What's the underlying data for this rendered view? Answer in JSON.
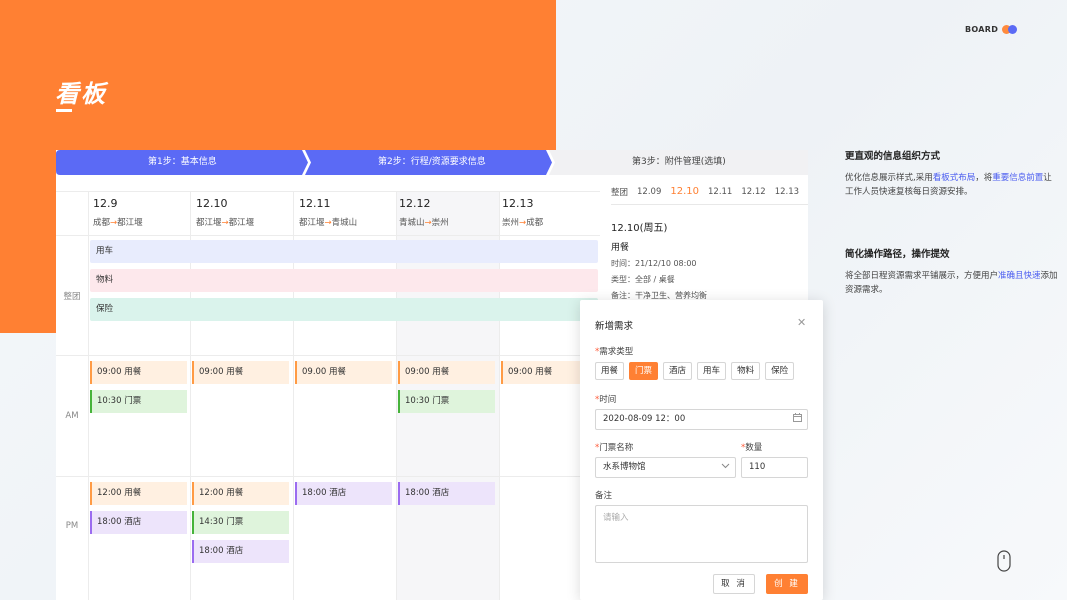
{
  "page": {
    "title": "看板",
    "brand": "BOARD"
  },
  "colors": {
    "accent": "#ff8033",
    "blue": "#5b6af5",
    "highlight": "#4a5cf0"
  },
  "steps": [
    {
      "label": "第1步：基本信息",
      "state": "done"
    },
    {
      "label": "第2步：行程/资源要求信息",
      "state": "active"
    },
    {
      "label": "第3步：附件管理(选填)",
      "state": "pending"
    }
  ],
  "days": [
    {
      "date": "12.9",
      "from": "成都",
      "to": "都江堰"
    },
    {
      "date": "12.10",
      "from": "都江堰",
      "to": "都江堰"
    },
    {
      "date": "12.11",
      "from": "都江堰",
      "to": "青城山"
    },
    {
      "date": "12.12",
      "from": "青城山",
      "to": "崇州"
    },
    {
      "date": "12.13",
      "from": "崇州",
      "to": "成都"
    }
  ],
  "rows": {
    "group": "整团",
    "am": "AM",
    "pm": "PM"
  },
  "group_bands": [
    {
      "label": "用车",
      "color": "#e8ecfd"
    },
    {
      "label": "物料",
      "color": "#fde8ec"
    },
    {
      "label": "保险",
      "color": "#daf3ec"
    }
  ],
  "am_events": [
    {
      "day": 0,
      "slot": 0,
      "time": "09:00",
      "label": "用餐",
      "kind": "meal"
    },
    {
      "day": 0,
      "slot": 1,
      "time": "10:30",
      "label": "门票",
      "kind": "ticket"
    },
    {
      "day": 1,
      "slot": 0,
      "time": "09:00",
      "label": "用餐",
      "kind": "meal"
    },
    {
      "day": 2,
      "slot": 0,
      "time": "09.00",
      "label": "用餐",
      "kind": "meal"
    },
    {
      "day": 3,
      "slot": 0,
      "time": "09:00",
      "label": "用餐",
      "kind": "meal"
    },
    {
      "day": 3,
      "slot": 1,
      "time": "10:30",
      "label": "门票",
      "kind": "ticket"
    },
    {
      "day": 4,
      "slot": 0,
      "time": "09:00",
      "label": "用餐",
      "kind": "meal"
    }
  ],
  "pm_events": [
    {
      "day": 0,
      "slot": 0,
      "time": "12:00",
      "label": "用餐",
      "kind": "meal"
    },
    {
      "day": 0,
      "slot": 1,
      "time": "18:00",
      "label": "酒店",
      "kind": "hotel"
    },
    {
      "day": 1,
      "slot": 0,
      "time": "12:00",
      "label": "用餐",
      "kind": "meal"
    },
    {
      "day": 1,
      "slot": 1,
      "time": "14:30",
      "label": "门票",
      "kind": "ticket"
    },
    {
      "day": 1,
      "slot": 2,
      "time": "18:00",
      "label": "酒店",
      "kind": "hotel"
    },
    {
      "day": 2,
      "slot": 0,
      "time": "18:00",
      "label": "酒店",
      "kind": "hotel"
    },
    {
      "day": 3,
      "slot": 0,
      "time": "18:00",
      "label": "酒店",
      "kind": "hotel"
    }
  ],
  "side_panel": {
    "tabs": [
      "整团",
      "12.09",
      "12.10",
      "12.11",
      "12.12",
      "12.13"
    ],
    "active_tab": "12.10",
    "detail": {
      "date": "12.10(周五)",
      "type": "用餐",
      "time": "时间：21/12/10 08:00",
      "category": "类型：全部 / 桌餐",
      "note": "备注：干净卫生、营养均衡"
    }
  },
  "modal": {
    "title": "新增需求",
    "type_label": "需求类型",
    "types": [
      "用餐",
      "门票",
      "酒店",
      "用车",
      "物料",
      "保险"
    ],
    "active_type": "门票",
    "time_label": "时间",
    "time_value": "2020-08-09 12：00",
    "ticket_label": "门票名称",
    "ticket_value": "水系博物馆",
    "qty_label": "数量",
    "qty_value": "110",
    "note_label": "备注",
    "note_placeholder": "请输入",
    "cancel": "取 消",
    "create": "创 建"
  },
  "descriptions": [
    {
      "title": "更直观的信息组织方式",
      "parts": [
        {
          "text": "优化信息展示样式,采用",
          "hl": false
        },
        {
          "text": "看板式布局",
          "hl": true
        },
        {
          "text": "，将",
          "hl": false
        },
        {
          "text": "重要信息前置",
          "hl": true
        },
        {
          "text": "让工作人员快速复核每日资源安排。",
          "hl": false
        }
      ]
    },
    {
      "title": "简化操作路径，操作提效",
      "parts": [
        {
          "text": "将全部日程资源需求平铺展示，方便用户",
          "hl": false
        },
        {
          "text": "准确且快速",
          "hl": true
        },
        {
          "text": "添加资源需求。",
          "hl": false
        }
      ]
    }
  ]
}
